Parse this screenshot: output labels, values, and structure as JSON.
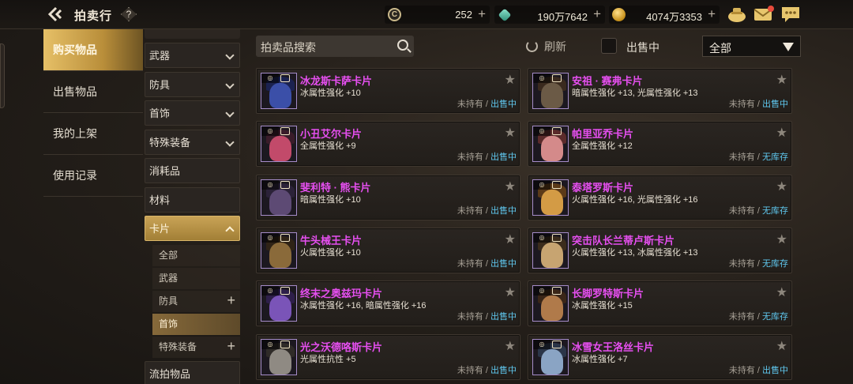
{
  "header": {
    "title": "拍卖行",
    "help_label": "?",
    "currencies": [
      {
        "icon": "chip-icon",
        "value": "252"
      },
      {
        "icon": "gem-icon",
        "value": "190万7642"
      },
      {
        "icon": "gold-coin-icon",
        "value": "4074万3353"
      }
    ],
    "chip_symbol": "C"
  },
  "leftnav": [
    "购买物品",
    "出售物品",
    "我的上架",
    "使用记录"
  ],
  "categories": {
    "weapon": "武器",
    "armor": "防具",
    "accessory": "首饰",
    "special": "特殊装备",
    "consumable": "消耗品",
    "material": "材料",
    "card": "卡片",
    "sub": [
      "全部",
      "武器",
      "防具",
      "首饰",
      "特殊装备"
    ],
    "epic": "流拍物品"
  },
  "filters": {
    "search_placeholder": "拍卖品搜索",
    "refresh_label": "刷新",
    "selling_label": "出售中",
    "dropdown_value": "全部"
  },
  "listings": [
    {
      "name": "冰龙斯卡萨卡片",
      "stat": "冰属性强化 +10",
      "owned": "未持有",
      "sep": " / ",
      "state": "出售中"
    },
    {
      "name": "安祖 · 赛弗卡片",
      "stat": "暗属性强化 +13, 光属性强化 +13",
      "owned": "未持有",
      "sep": " / ",
      "state": "出售中"
    },
    {
      "name": "小丑艾尔卡片",
      "stat": "全属性强化 +9",
      "owned": "未持有",
      "sep": " / ",
      "state": "出售中"
    },
    {
      "name": "帕里亚乔卡片",
      "stat": "全属性强化 +12",
      "owned": "未持有",
      "sep": " / ",
      "state": "无库存"
    },
    {
      "name": "斐利特 · 熊卡片",
      "stat": "暗属性强化 +10",
      "owned": "未持有",
      "sep": " / ",
      "state": "出售中"
    },
    {
      "name": "泰塔罗斯卡片",
      "stat": "火属性强化 +16, 光属性强化 +16",
      "owned": "未持有",
      "sep": " / ",
      "state": "无库存"
    },
    {
      "name": "牛头械王卡片",
      "stat": "火属性强化 +10",
      "owned": "未持有",
      "sep": " / ",
      "state": "出售中"
    },
    {
      "name": "突击队长兰蒂卢斯卡片",
      "stat": "火属性强化 +13, 冰属性强化 +13",
      "owned": "未持有",
      "sep": " / ",
      "state": "无库存"
    },
    {
      "name": "终末之奥兹玛卡片",
      "stat": "冰属性强化 +16, 暗属性强化 +16",
      "owned": "未持有",
      "sep": " / ",
      "state": "出售中"
    },
    {
      "name": "长脚罗特斯卡片",
      "stat": "冰属性强化 +15",
      "owned": "未持有",
      "sep": " / ",
      "state": "无库存"
    },
    {
      "name": "光之沃德咯斯卡片",
      "stat": "光属性抗性 +5",
      "owned": "未持有",
      "sep": " / ",
      "state": "出售中"
    },
    {
      "name": "冰雪女王洛丝卡片",
      "stat": "冰属性强化 +7",
      "owned": "未持有",
      "sep": " / ",
      "state": "出售中"
    }
  ],
  "colors": {
    "accent_gold": "#e6c067",
    "item_name_purple": "#e64ff0",
    "status_blue": "#5fc7ee",
    "thumb_border": "#a58cc9"
  }
}
